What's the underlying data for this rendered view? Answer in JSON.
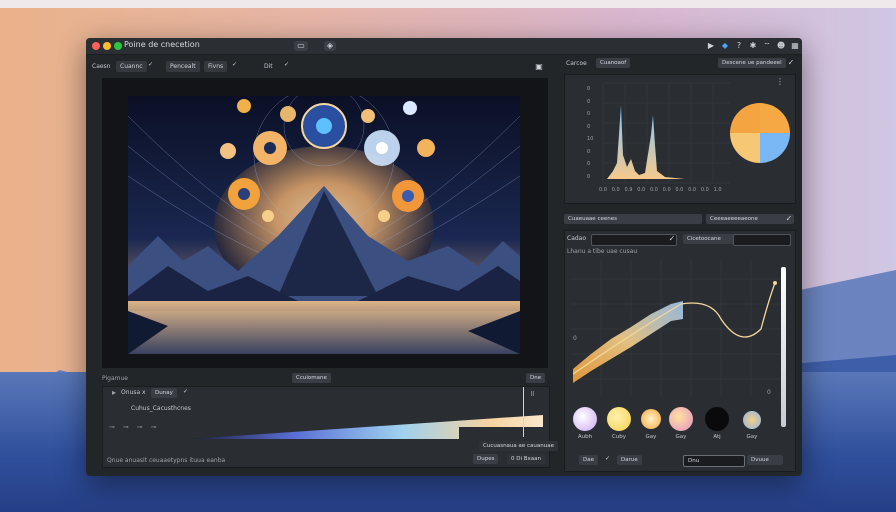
{
  "window": {
    "title": "Poine de cnecetion"
  },
  "titlebar_icons": [
    "play-icon",
    "shape-icon",
    "help-icon",
    "settings-icon",
    "wifi-icon",
    "user-icon",
    "grid-icon"
  ],
  "toolbar": {
    "label1": "Caesn",
    "btn1": "Cuannc",
    "btn2": "Pencealt",
    "btn3": "Fivns",
    "btn4": "Dit",
    "check": "✓"
  },
  "canvas": {
    "status_left": "Pigamue",
    "status_btn": "Ccuiomane",
    "status_btn2": "Dne"
  },
  "timeline": {
    "tab1": "Onusa x",
    "tab2": "Dunay",
    "title": "Cuhus_Cacusthcnes",
    "caption": "Cucuasnaua ae cauanuae",
    "footer": "Qnue anuasit ceuaaetypns ituua eanba",
    "btn1": "Dupes",
    "btn2": "0 Di Bxaan"
  },
  "right_top": {
    "btn1": "Carcoe",
    "btn2": "Cuanoaof",
    "btn3": "Descene ue pandeeel",
    "y_ticks": [
      "0",
      "0",
      "0",
      "0",
      "10",
      "0",
      "0",
      "0"
    ],
    "x_ticks": [
      "0.0",
      "0.0",
      "0.9",
      "0.0",
      "0.0",
      "0.0",
      "0.0",
      "0.0",
      "0.0",
      "1.0"
    ]
  },
  "right_mid": {
    "btn1": "Cuaeuaae ceenes",
    "btn2": "Ceeeaeeeeaeone",
    "btn3": "Cadao",
    "btn4": "Cicetoocane",
    "label": "Lhanu a  tibe uae cusau",
    "ylabel_top": "0",
    "ylabel_bottom": "0"
  },
  "swatches": [
    {
      "label": "Aubh",
      "color": "#c9a6f0"
    },
    {
      "label": "Cuby",
      "color": "#f5cf4a"
    },
    {
      "label": "Gay",
      "color": "#f3a63a"
    },
    {
      "label": "Gay",
      "color": "#e58fc5"
    },
    {
      "label": "Atj",
      "color": "#0a0a0c"
    },
    {
      "label": "Gay",
      "color": "#8fb5f0"
    }
  ],
  "right_bottom": {
    "btn1": "Dae",
    "btn2": "Darue",
    "btn3": "Dnu",
    "btn4": "Dvuue"
  }
}
